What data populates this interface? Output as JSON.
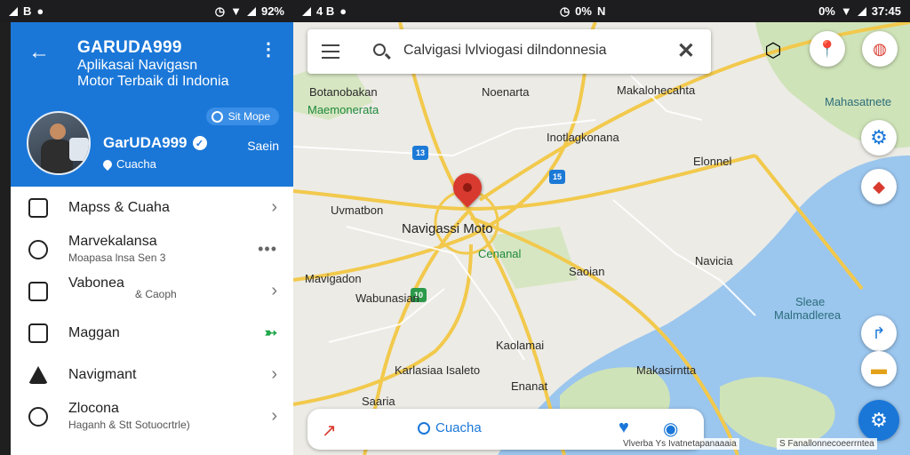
{
  "status_left": {
    "signal": "4",
    "icons": "B",
    "battery": "92%"
  },
  "status_right": {
    "left_icons": "4 B",
    "center": "0%",
    "center_suffix": "N",
    "right_text": "0%",
    "time": "37:45"
  },
  "drawer": {
    "title": "GARUDA999",
    "subtitle1": "Aplikasai Navigasn",
    "subtitle2": "Motor Terbaik di Indonia",
    "chip_label": "Sit Mope",
    "user_name": "GarUDA999",
    "user_status": "Cuacha",
    "user_action": "Saein",
    "menu": [
      {
        "label": "Mapss & Cuaha",
        "sub": "",
        "right": "chevron"
      },
      {
        "label": "Marvekalansa",
        "sub": "Moapasa lnsa Sen 3",
        "right": "dots"
      },
      {
        "label": "Vabonea",
        "sub": "& Caoph",
        "right": "chevron"
      },
      {
        "label": "Maggan",
        "sub": "",
        "right": "green"
      },
      {
        "label": "Navigmant",
        "sub": "",
        "right": "chevron"
      },
      {
        "label": "Zlocona",
        "sub": "Haganh & Stt Sotuocrtrle)",
        "right": "chevron"
      }
    ],
    "dots_text": "•••",
    "green_text": "➳",
    "chevron_text": "›"
  },
  "map": {
    "search_text": "Calvigasi lvlviogasi dilndonnesia",
    "labels": {
      "l1": "Botanobakan",
      "l2": "Maemonerata",
      "l3": "Noenarta",
      "l4": "Makalohecahta",
      "l5": "Mahasatnete",
      "l6": "Inotlagkonana",
      "l7": "Elonnel",
      "l8": "Uvmatbon",
      "l9": "Navigassi Moto",
      "l10": "Cenanal",
      "l11": "Navicia",
      "l12": "Saoian",
      "l13": "Mavigadon",
      "l14": "Wabunasian",
      "l15": "Sleae",
      "l16": "Malmadlerea",
      "l17": "Kaolamai",
      "l18": "Karlasiaa Isaleto",
      "l19": "Enanat",
      "l20": "Makasirntta",
      "l21": "Saaria"
    },
    "badges": {
      "b1": "13",
      "b2": "15",
      "b3": "10"
    },
    "bottom_label": "Cuacha",
    "attribution1": "Vlverba Ys Ivatnetapanaaaia",
    "attribution2": "S Fanallonnecoeerrntea"
  }
}
